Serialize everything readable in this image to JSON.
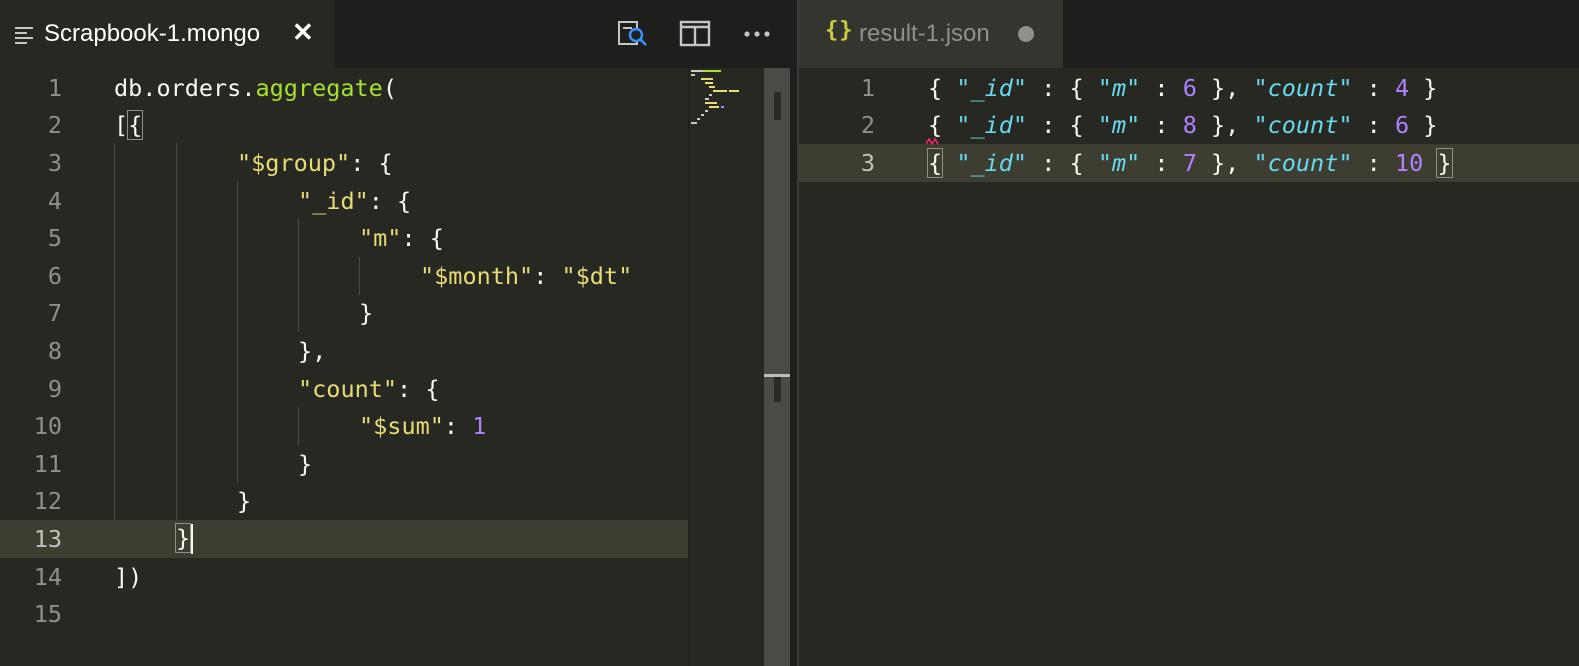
{
  "left_editor": {
    "tab": {
      "label": "Scrapbook-1.mongo",
      "close_glyph": "✕",
      "icon": "file-lines-icon"
    },
    "actions": [
      {
        "name": "find-in-file-icon",
        "title": ""
      },
      {
        "name": "split-editor-icon",
        "title": ""
      },
      {
        "name": "more-actions-icon",
        "title": ""
      }
    ],
    "line_numbers": [
      "1",
      "2",
      "3",
      "4",
      "5",
      "6",
      "7",
      "8",
      "9",
      "10",
      "11",
      "12",
      "13",
      "14",
      "15"
    ],
    "current_line": "13",
    "code": {
      "l1_obj": "db.orders.",
      "l1_func": "aggregate",
      "l1_paren": "(",
      "l2_open": "[",
      "l2_brace": "{",
      "l3_key": "\"$group\"",
      "l3_rest": ": {",
      "l4_key": "\"_id\"",
      "l4_rest": ": {",
      "l5_key": "\"m\"",
      "l5_rest": ": {",
      "l6_key": "\"$month\"",
      "l6_colon": ": ",
      "l6_val": "\"$dt\"",
      "l7": "}",
      "l8": "},",
      "l9_key": "\"count\"",
      "l9_rest": ": {",
      "l10_key": "\"$sum\"",
      "l10_colon": ": ",
      "l10_val": "1",
      "l11": "}",
      "l12": "}",
      "l13": "}",
      "l14": "])"
    }
  },
  "right_editor": {
    "tab": {
      "label": "result-1.json",
      "icon_glyph": "{}",
      "dirty": true
    },
    "line_numbers": [
      "1",
      "2",
      "3"
    ],
    "current_line": "3",
    "results": [
      {
        "id_key": "\"_id\"",
        "m_key": "\"m\"",
        "m_val": "6",
        "count_key": "\"count\"",
        "count_val": "4"
      },
      {
        "id_key": "\"_id\"",
        "m_key": "\"m\"",
        "m_val": "8",
        "count_key": "\"count\"",
        "count_val": "6"
      },
      {
        "id_key": "\"_id\"",
        "m_key": "\"m\"",
        "m_val": "7",
        "count_key": "\"count\"",
        "count_val": "10"
      }
    ]
  },
  "colors": {
    "background": "#272822",
    "function": "#a6e22e",
    "string": "#e6db74",
    "number": "#ae81ff",
    "json_key": "#66d9ef",
    "icon_yellow": "#cbcb41"
  }
}
